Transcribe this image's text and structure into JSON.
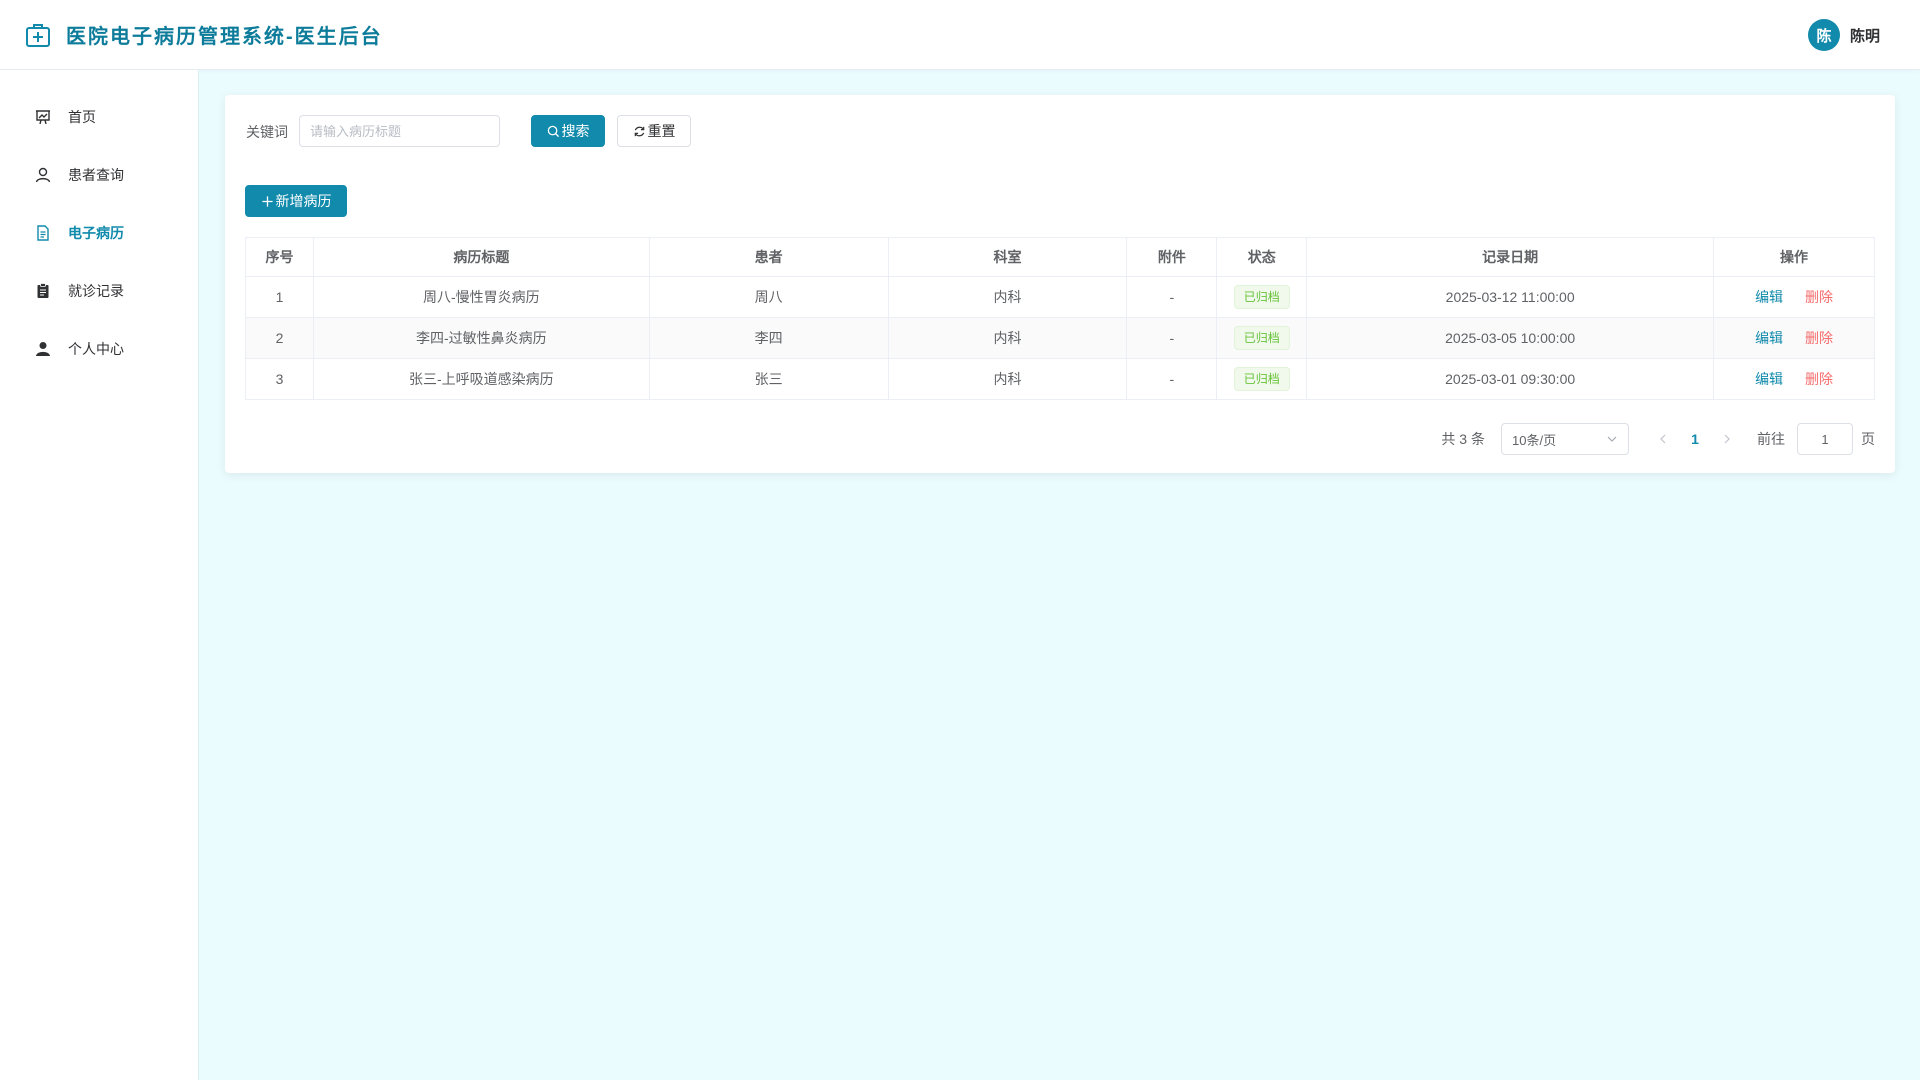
{
  "header": {
    "title": "医院电子病历管理系统-医生后台",
    "brand_icon": "medical-kit-icon",
    "user": {
      "avatar_text": "陈",
      "name": "陈明"
    }
  },
  "sidebar": {
    "items": [
      {
        "label": "首页",
        "icon": "dashboard-icon",
        "active": false
      },
      {
        "label": "患者查询",
        "icon": "user-outline-icon",
        "active": false
      },
      {
        "label": "电子病历",
        "icon": "document-icon",
        "active": true
      },
      {
        "label": "就诊记录",
        "icon": "clipboard-icon",
        "active": false
      },
      {
        "label": "个人中心",
        "icon": "user-filled-icon",
        "active": false
      }
    ]
  },
  "search": {
    "label": "关键词",
    "placeholder": "请输入病历标题",
    "value": "",
    "search_button": "搜索",
    "reset_button": "重置"
  },
  "toolbar": {
    "add_button": "新增病历"
  },
  "table": {
    "columns": [
      "序号",
      "病历标题",
      "患者",
      "科室",
      "附件",
      "状态",
      "记录日期",
      "操作"
    ],
    "rows": [
      {
        "index": "1",
        "title": "周八-慢性胃炎病历",
        "patient": "周八",
        "dept": "内科",
        "attachment": "-",
        "status": "已归档",
        "date": "2025-03-12 11:00:00",
        "edit": "编辑",
        "delete": "删除"
      },
      {
        "index": "2",
        "title": "李四-过敏性鼻炎病历",
        "patient": "李四",
        "dept": "内科",
        "attachment": "-",
        "status": "已归档",
        "date": "2025-03-05 10:00:00",
        "edit": "编辑",
        "delete": "删除"
      },
      {
        "index": "3",
        "title": "张三-上呼吸道感染病历",
        "patient": "张三",
        "dept": "内科",
        "attachment": "-",
        "status": "已归档",
        "date": "2025-03-01 09:30:00",
        "edit": "编辑",
        "delete": "删除"
      }
    ]
  },
  "pagination": {
    "total_text": "共 3 条",
    "page_size": "10条/页",
    "current_page": "1",
    "goto_label": "前往",
    "goto_value": "1",
    "page_suffix": "页"
  },
  "colors": {
    "primary": "#118aab",
    "danger": "#f56c6c",
    "success": "#67c23a",
    "background": "#ebfcff"
  }
}
